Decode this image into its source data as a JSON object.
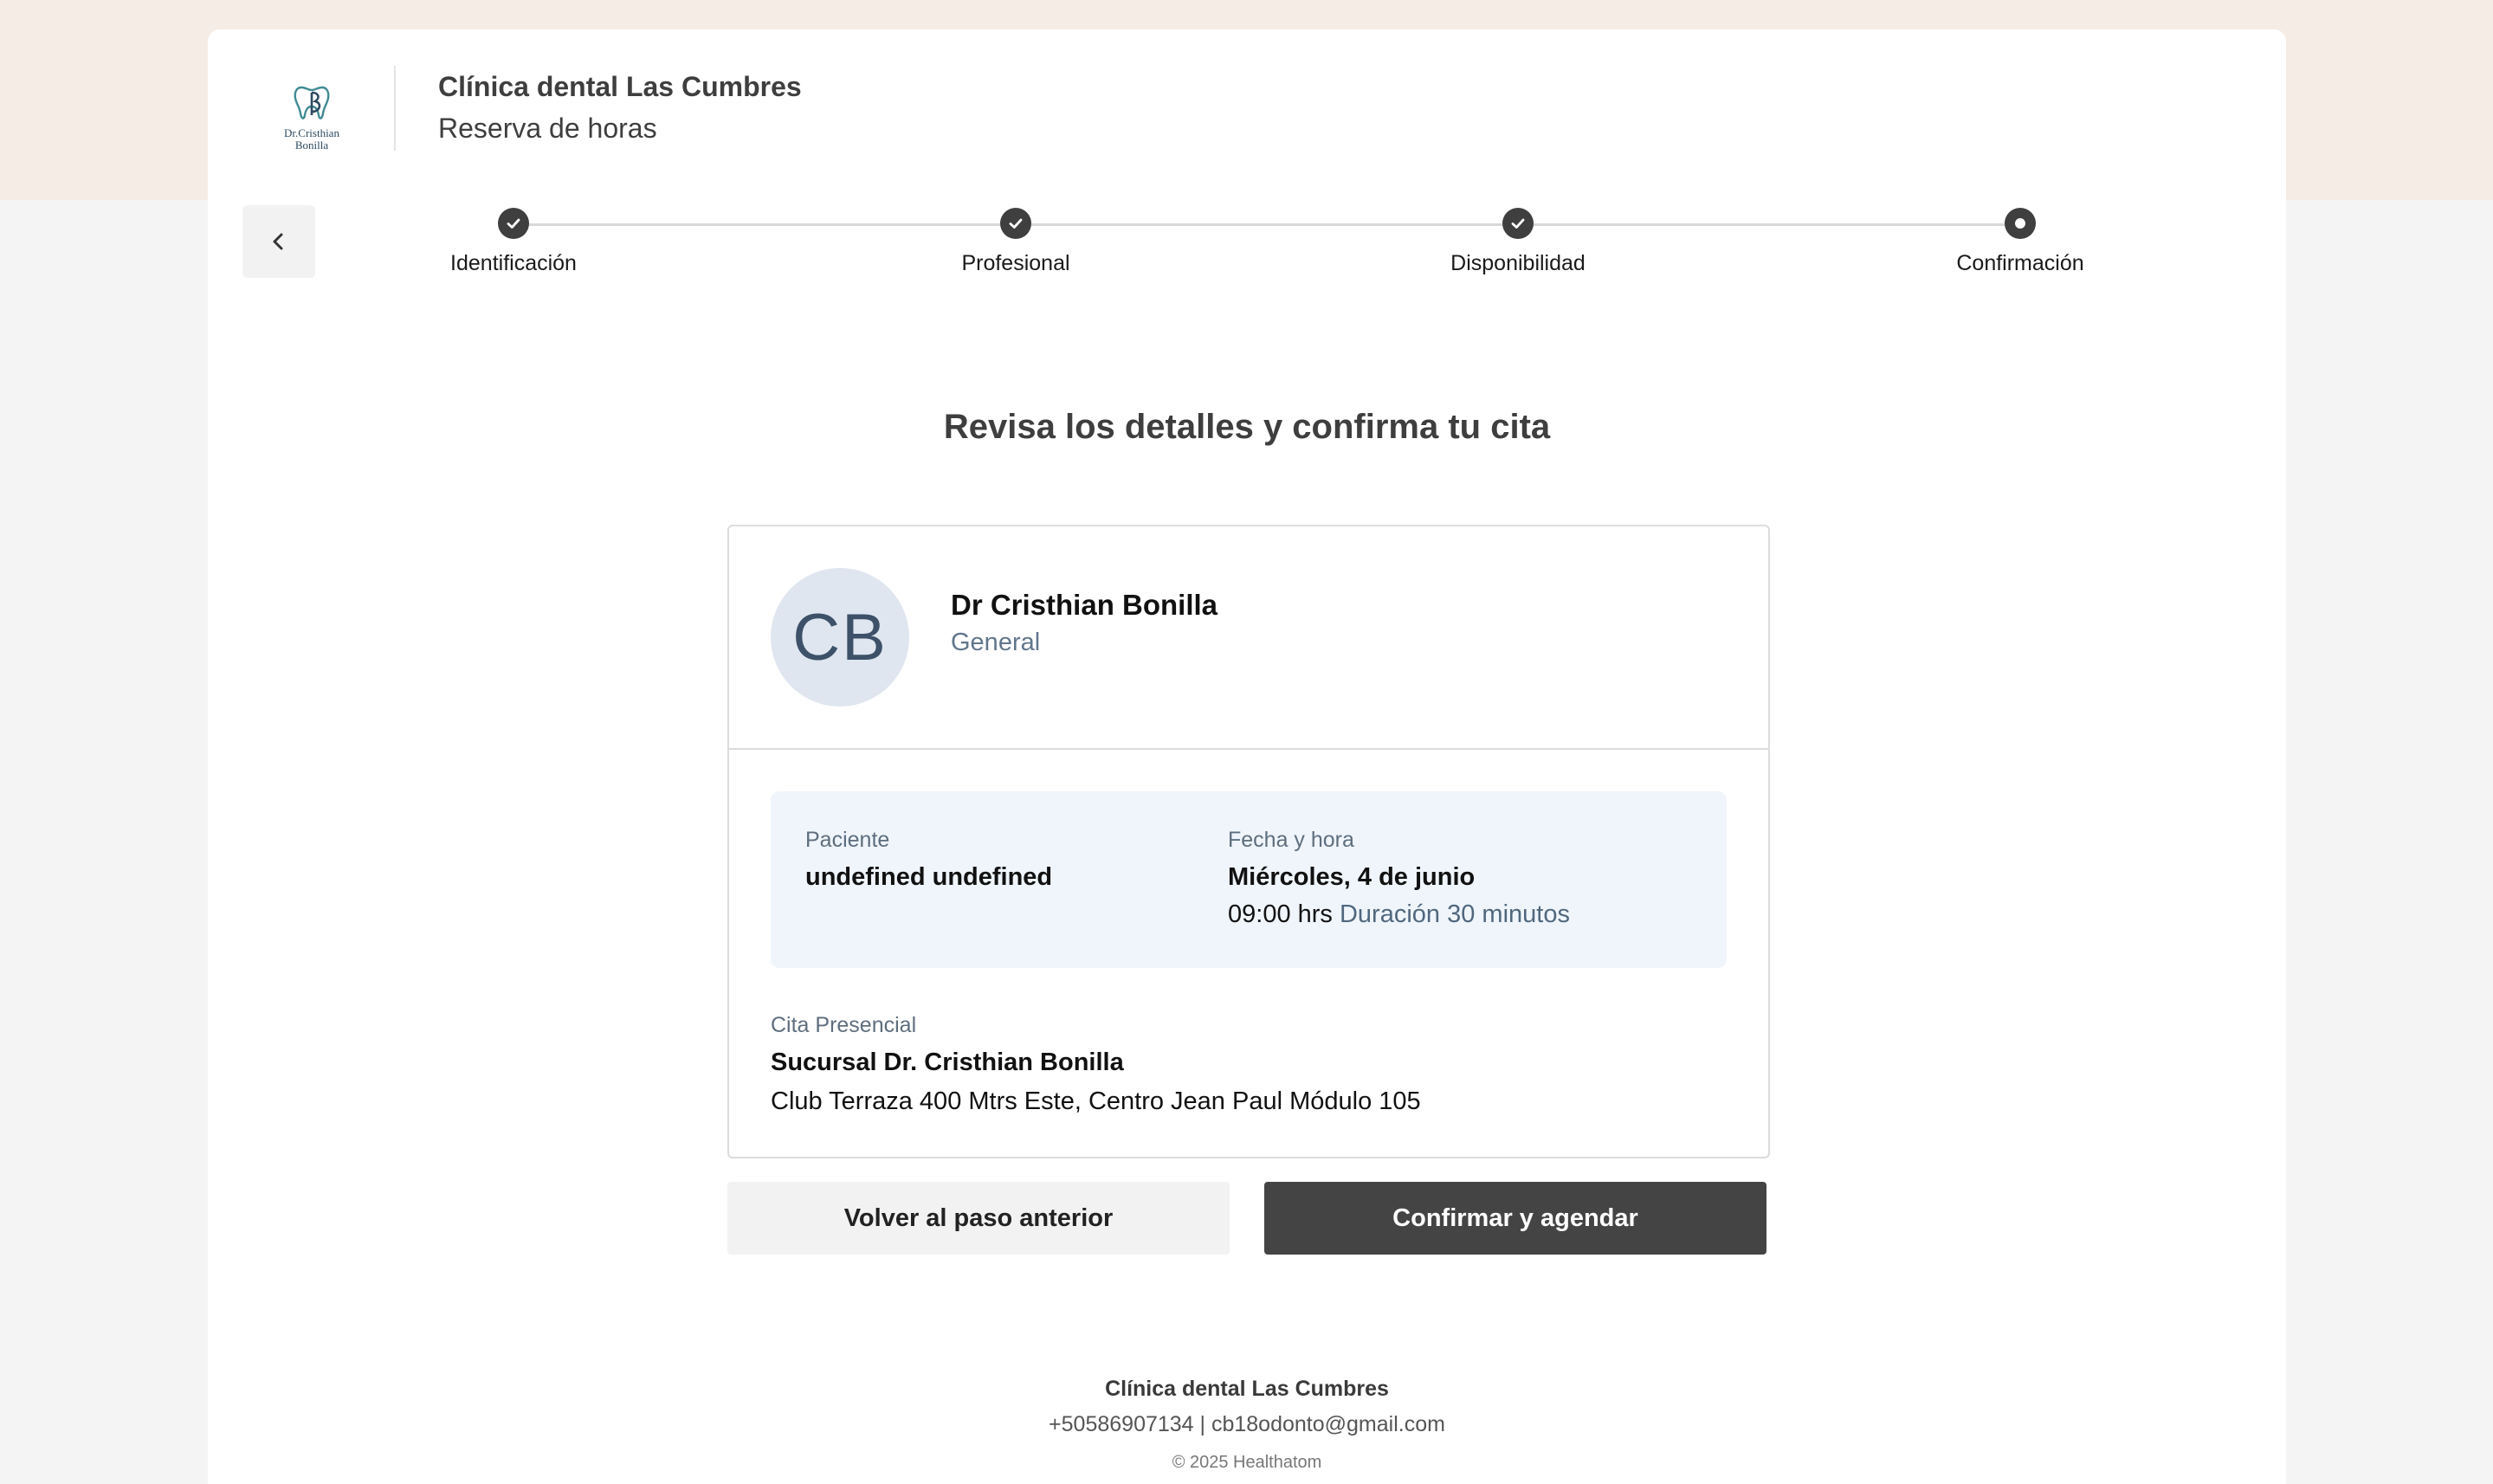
{
  "header": {
    "logo_text": "Dr.Cristhian Bonilla",
    "clinic_name": "Clínica dental Las Cumbres",
    "subtitle": "Reserva de horas"
  },
  "stepper": {
    "steps": [
      {
        "label": "Identificación",
        "status": "done"
      },
      {
        "label": "Profesional",
        "status": "done"
      },
      {
        "label": "Disponibilidad",
        "status": "done"
      },
      {
        "label": "Confirmación",
        "status": "current"
      }
    ]
  },
  "page_title": "Revisa los detalles y confirma tu cita",
  "professional": {
    "initials": "CB",
    "name": "Dr Cristhian Bonilla",
    "specialty": "General"
  },
  "appointment": {
    "patient_label": "Paciente",
    "patient_value": "undefined undefined",
    "datetime_label": "Fecha y hora",
    "date_value": "Miércoles, 4 de junio",
    "time_value": "09:00 hrs",
    "duration_value": "Duración 30 minutos"
  },
  "location": {
    "label": "Cita Presencial",
    "branch": "Sucursal Dr. Cristhian Bonilla",
    "address": "Club Terraza 400 Mtrs Este, Centro Jean Paul Módulo 105"
  },
  "actions": {
    "back_label": "Volver al paso anterior",
    "confirm_label": "Confirmar y agendar"
  },
  "footer": {
    "name": "Clínica dental Las Cumbres",
    "contact": "+50586907134 | cb18odonto@gmail.com",
    "copyright": "© 2025 Healthatom"
  },
  "colors": {
    "top_band": "#f6ece6",
    "primary_dark": "#444444",
    "info_box": "#eff5fb",
    "avatar_bg": "#dfe6ef"
  }
}
